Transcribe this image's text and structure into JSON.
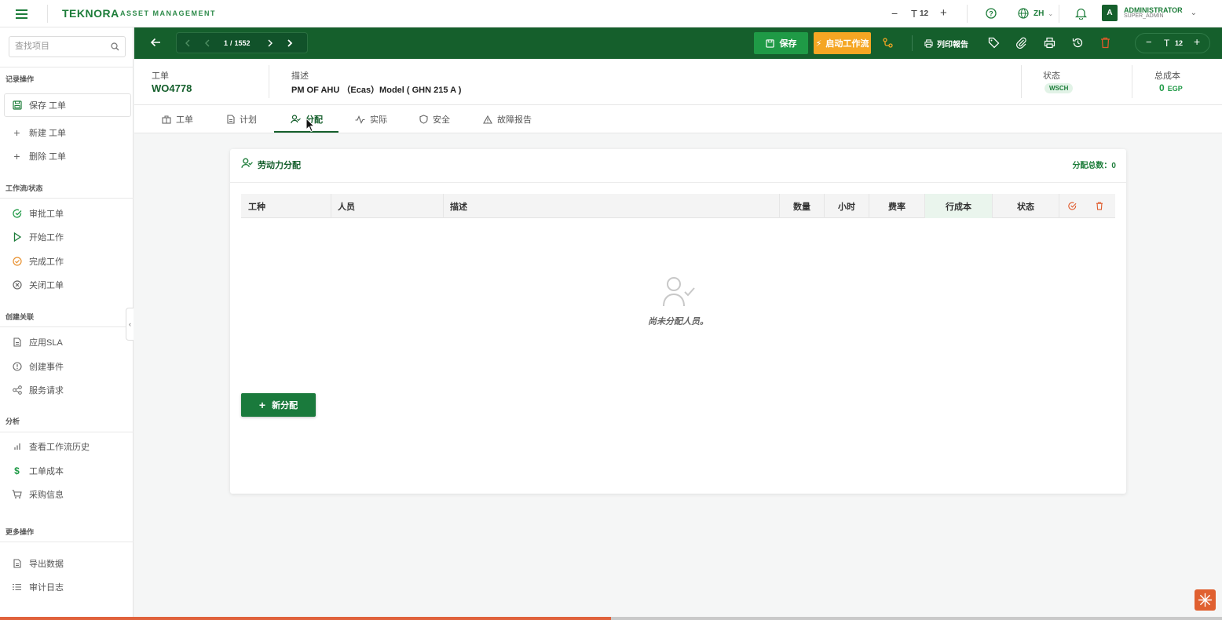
{
  "topbar": {
    "brand": "TEKNORA",
    "brand_sub": "ASSET MANAGEMENT",
    "font_size": "12",
    "language": "ZH",
    "user_initial": "A",
    "user_name": "ADMINISTRATOR",
    "user_role": "SUPER_ADMIN"
  },
  "sidebar": {
    "search_placeholder": "查找项目",
    "sections": {
      "record": "记录操作",
      "workflow": "工作流/状态",
      "relations": "创建关联",
      "analysis": "分析",
      "more": "更多操作"
    },
    "items": {
      "save": "保存 工单",
      "new": "新建 工单",
      "delete": "删除 工单",
      "approve": "审批工单",
      "start": "开始工作",
      "complete": "完成工作",
      "close": "关闭工单",
      "sla": "应用SLA",
      "event": "创建事件",
      "service": "服务请求",
      "history": "查看工作流历史",
      "cost": "工单成本",
      "purchase": "采购信息",
      "export": "导出数据",
      "audit": "审计日志"
    },
    "collapse": "‹"
  },
  "toolbar": {
    "page_current": "1",
    "page_sep": "/",
    "page_total": "1552",
    "save_label": "保存",
    "workflow_label": "启动工作流",
    "print_report_label": "列印報告",
    "font_size": "12"
  },
  "header": {
    "wo_label": "工单",
    "wo_value": "WO4778",
    "desc_label": "描述",
    "desc_value": "PM OF AHU （Ecas）Model ( GHN 215 A )",
    "status_label": "状态",
    "status_value": "WSCH",
    "cost_label": "总成本",
    "cost_value": "0",
    "cost_currency": "EGP"
  },
  "tabs": [
    {
      "label": "工单"
    },
    {
      "label": "计划"
    },
    {
      "label": "分配"
    },
    {
      "label": "实际"
    },
    {
      "label": "安全"
    },
    {
      "label": "故障报告"
    }
  ],
  "labor": {
    "title": "劳动力分配",
    "total_label": "分配总数：0",
    "columns": [
      "工种",
      "人员",
      "描述",
      "数量",
      "小时",
      "费率",
      "行成本",
      "状态"
    ],
    "empty_message": "尚未分配人员。",
    "add_button": "新分配"
  },
  "progress": {
    "fraction": 0.5
  },
  "colors": {
    "primary_green": "#155f2c",
    "accent_green": "#1f9a46",
    "orange": "#f5a623",
    "danger": "#e05a2b"
  }
}
